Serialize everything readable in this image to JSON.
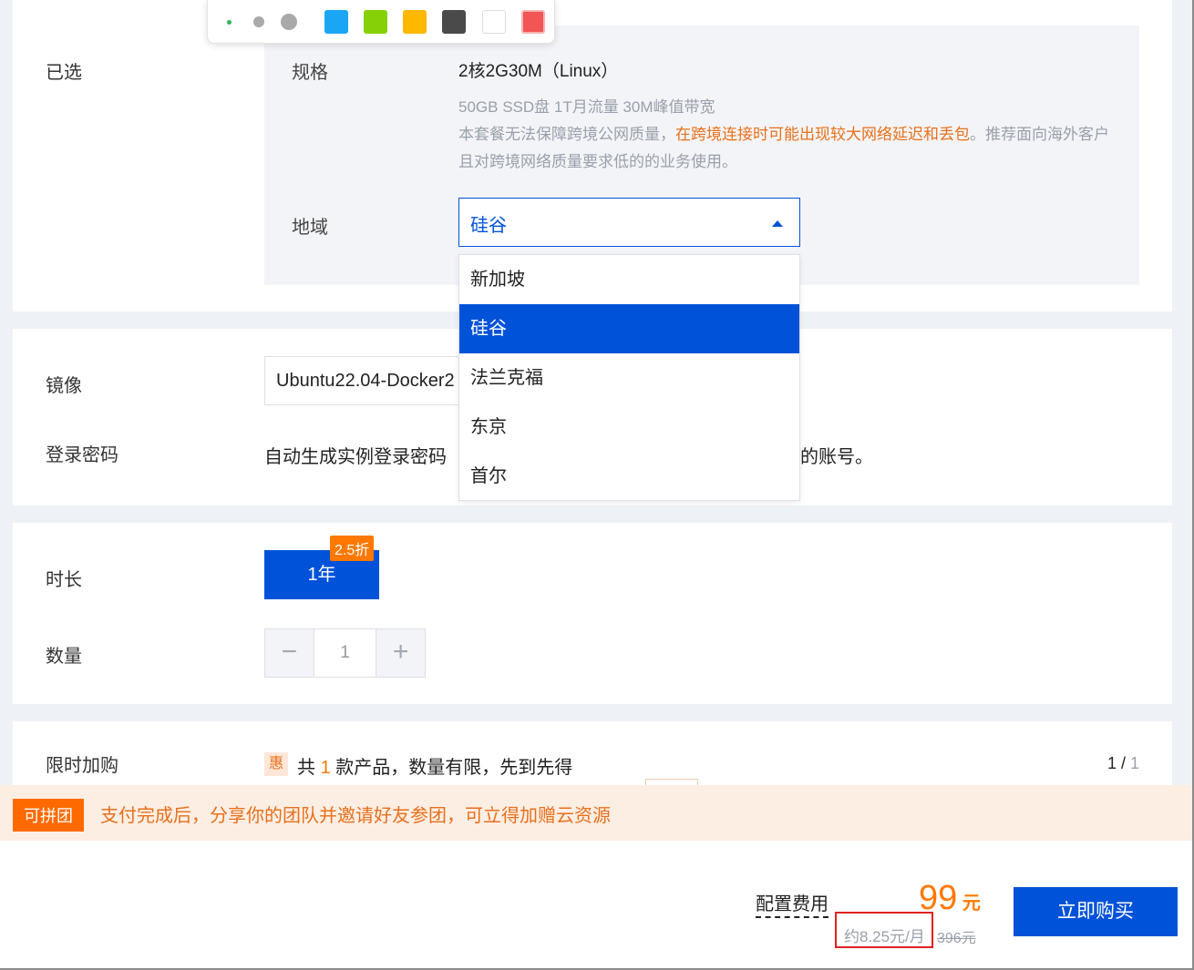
{
  "toolbar": {
    "swatches": [
      "#1aa6f5",
      "#86d007",
      "#ffb800",
      "#4a4a4a",
      "#ffffff",
      "#f25555"
    ]
  },
  "selected": {
    "label": "已选",
    "spec_key": "规格",
    "spec_value": "2核2G30M（Linux）",
    "spec_detail": "50GB SSD盘 1T月流量 30M峰值带宽",
    "notice_pre": "本套餐无法保障跨境公网质量，",
    "notice_warn": "在跨境连接时可能出现较大网络延迟和丢包",
    "notice_post": "。推荐面向海外客户且对跨境网络质量要求低的的业务使用。",
    "region_key": "地域",
    "region_value": "硅谷"
  },
  "region_dropdown": {
    "options": [
      "新加坡",
      "硅谷",
      "法兰克福",
      "东京",
      "首尔"
    ],
    "selected_index": 1
  },
  "image_section": {
    "label": "镜像",
    "value": "Ubuntu22.04-Docker2",
    "password_label": "登录密码",
    "password_text": "自动生成实例登录密码",
    "password_text_tail": "的账号。"
  },
  "duration_section": {
    "label": "时长",
    "option": "1年",
    "discount_badge": "2.5折",
    "quantity_label": "数量",
    "minus": "−",
    "plus": "+",
    "quantity": "1"
  },
  "addon_section": {
    "label": "限时加购",
    "tag": "惠",
    "text_pre": "共 ",
    "count": "1",
    "text_post": " 款产品，数量有限，先到先得",
    "page_current": "1 / ",
    "page_total": "1"
  },
  "group_banner": {
    "tag": "可拼团",
    "text": "支付完成后，分享你的团队并邀请好友参团，可立得加赠云资源"
  },
  "footer": {
    "fee_label": "配置费用",
    "price": "99",
    "price_unit": " 元",
    "monthly": "约8.25元/月",
    "original_price": "396元",
    "buy_label": "立即购买"
  }
}
